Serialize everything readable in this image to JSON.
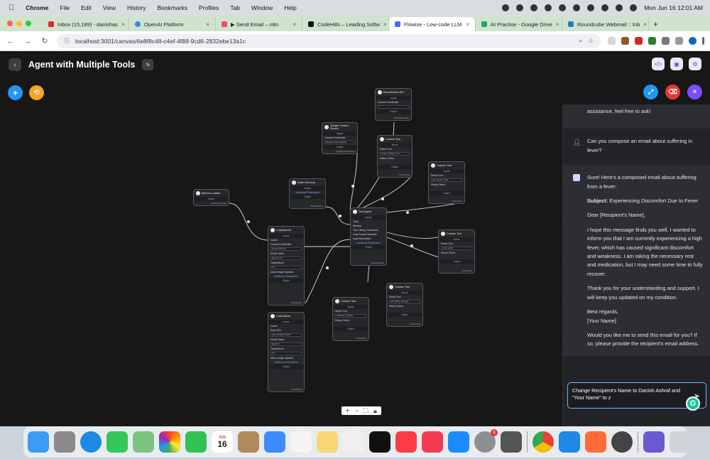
{
  "menubar": {
    "apple": "",
    "app": "Chrome",
    "items": [
      "File",
      "Edit",
      "View",
      "History",
      "Bookmarks",
      "Profiles",
      "Tab",
      "Window",
      "Help"
    ],
    "clock": "Mon Jun 16  12:01 AM"
  },
  "tabs": [
    {
      "label": "Inbox (15,189) - danishas",
      "color": "#d93025",
      "active": false
    },
    {
      "label": "OpenAI Platform",
      "color": "#3b82f6",
      "active": false
    },
    {
      "label": "▶ Send Email – n8n",
      "color": "#ea4b71",
      "active": false
    },
    {
      "label": "CodeHills – Leading Softw",
      "color": "#111",
      "active": false
    },
    {
      "label": "Flowise - Low-code LLM",
      "color": "#4a6cf7",
      "active": true
    },
    {
      "label": "AI Practise - Google Drive",
      "color": "#1fa463",
      "active": false
    },
    {
      "label": "Roundcube Webmail :: Inb",
      "color": "#2b7bb9",
      "active": false
    }
  ],
  "url": "localhost:3001/canvas/6e8f8c48-c4ef-4f88-9cd6-2832ebe13a1c",
  "header": {
    "title": "Agent with Multiple Tools"
  },
  "nodes": [
    {
      "id": "brave",
      "title": "BraveSearch API",
      "band": "Inputs",
      "rows": [
        "Connect Credential"
      ],
      "out": "Output",
      "foot": "BraveSearchAPI"
    },
    {
      "id": "gsearch",
      "title": "Google Custom Search",
      "band": "Inputs",
      "rows": [
        "Connect Credential",
        "Google Custom Search"
      ],
      "out": "Output",
      "foot": "GoogleCustomSearch"
    },
    {
      "id": "custom1",
      "title": "Custom Tool",
      "band": "Inputs",
      "rows": [
        "Select Tool",
        "create_hubspot_cont...",
        "Return Direct"
      ],
      "out": "Output",
      "foot": "CustomTool"
    },
    {
      "id": "custom2",
      "title": "Custom Tool",
      "band": "Inputs",
      "rows": [
        "Select Tool",
        "get_weather_data",
        "Return Direct"
      ],
      "out": "Output",
      "foot": "CustomTool"
    },
    {
      "id": "memlocal",
      "title": "Memory Loader",
      "band": "",
      "rows": [],
      "out": "Output",
      "foot": "DocumentLoader"
    },
    {
      "id": "buffer",
      "title": "Buffer Memory",
      "band": "Inputs",
      "rows": [
        "Additional Parameters"
      ],
      "out": "Output",
      "foot": "BufferMemory"
    },
    {
      "id": "toolagent",
      "title": "Tool Agent",
      "band": "Inputs",
      "rows": [
        "Tools",
        "Memory",
        "Tool Calling Chat Model",
        "Chat Prompt Template",
        "Input Moderation",
        "Additional Parameters"
      ],
      "out": "Output",
      "foot": "AgentExecutor"
    },
    {
      "id": "custom3",
      "title": "Custom Tool",
      "band": "Inputs",
      "rows": [
        "Select Tool",
        "send_email",
        "Return Direct"
      ],
      "out": "Output",
      "foot": "CustomTool"
    },
    {
      "id": "chatopenai",
      "title": "ChatOpenAI",
      "band": "Inputs",
      "rows": [
        "Cache",
        "Connect Credential",
        "OpenAI API Key",
        "Model Name",
        "gpt-4.1-mini",
        "Temperature",
        "0.9",
        "Allow Image Uploads",
        "Additional Parameters"
      ],
      "out": "Output",
      "foot": "ChatOpenAI"
    },
    {
      "id": "custom4",
      "title": "Custom Tool",
      "band": "Inputs",
      "rows": [
        "Select Tool",
        "add_slack_message",
        "Return Direct"
      ],
      "out": "Output",
      "foot": "CustomTool"
    },
    {
      "id": "custom5",
      "title": "Custom Tool",
      "band": "Inputs",
      "rows": [
        "Select Tool",
        "calculator_distance",
        "Return Direct"
      ],
      "out": "Output",
      "foot": "CustomTool"
    },
    {
      "id": "chatollama",
      "title": "ChatOllama",
      "band": "Inputs",
      "rows": [
        "Cache",
        "Base URL",
        "http://localhost:11434",
        "Model Name",
        "llama3.2",
        "Temperature",
        "0.9",
        "Allow Image Uploads",
        "Additional Parameters"
      ],
      "out": "Output",
      "foot": "ChatOllama"
    }
  ],
  "chat": {
    "messages": [
      {
        "role": "bot",
        "text": "assistance, feel free to ask!"
      },
      {
        "role": "user",
        "text": "Can you compose an email about suffering in fever?"
      },
      {
        "role": "bot",
        "paragraphs": [
          "Sure! Here's a composed email about suffering from a fever:",
          "Subject: Experiencing Discomfort Due to Fever",
          "Dear [Recipient's Name],",
          "I hope this message finds you well. I wanted to inform you that I am currently experiencing a high fever, which has caused significant discomfort and weakness. I am taking the necessary rest and medication, but I may need some time to fully recover.",
          "Thank you for your understanding and support. I will keep you updated on my condition.",
          "Best regards,\n[Your Name]",
          "Would you like me to send this email for you? If so, please provide the recipient's email address."
        ]
      }
    ],
    "subject_label": "Subject:",
    "subject_text": " Experiencing Discomfort Due to Fever",
    "input_value": "Change Recipient's Name to Danish Ashraf and \"Your Name\" to z"
  },
  "calendar": {
    "month": "JUN",
    "day": "16"
  },
  "dock_badge": "1",
  "colors": {
    "accent": "#2196f3",
    "orange": "#f5a623",
    "red": "#e53935",
    "purple": "#7c4dff",
    "input_border": "#7bb0ff"
  }
}
